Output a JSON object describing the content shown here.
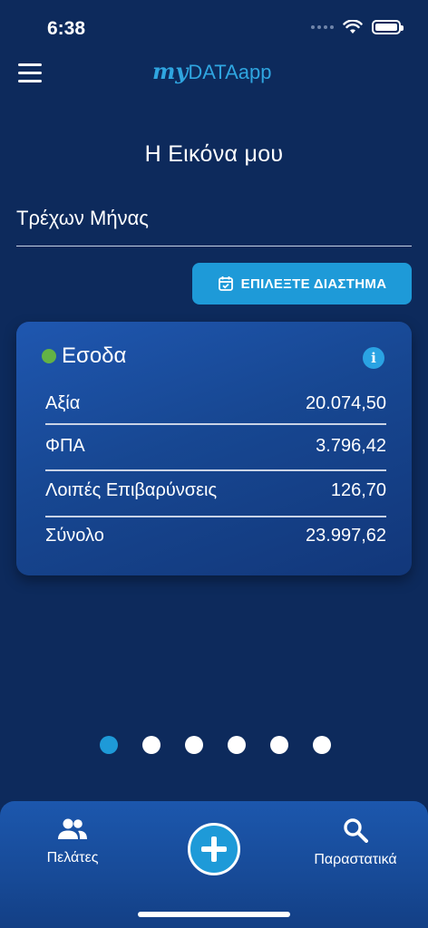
{
  "status_bar": {
    "time": "6:38"
  },
  "header": {
    "logo_my": "my",
    "logo_data": "DATA",
    "logo_app": "app"
  },
  "page": {
    "title": "Η Εικόνα μου"
  },
  "period": {
    "value": "Τρέχων Μήνας",
    "button_label": "ΕΠΙΛΕΞΤΕ ΔΙΑΣΤΗΜΑ"
  },
  "card": {
    "title": "Εσοδα",
    "status_color": "#63b245",
    "rows": [
      {
        "label": "Αξία",
        "value": "20.074,50"
      },
      {
        "label": "ΦΠΑ",
        "value": "3.796,42"
      },
      {
        "label": "Λοιπές Επιβαρύνσεις",
        "value": "126,70"
      },
      {
        "label": "Σύνολο",
        "value": "23.997,62"
      }
    ]
  },
  "pager": {
    "total": 6,
    "active_index": 0
  },
  "bottom_nav": {
    "clients_label": "Πελάτες",
    "documents_label": "Παραστατικά"
  },
  "colors": {
    "background": "#0d2a5c",
    "accent": "#1e9ad8"
  }
}
